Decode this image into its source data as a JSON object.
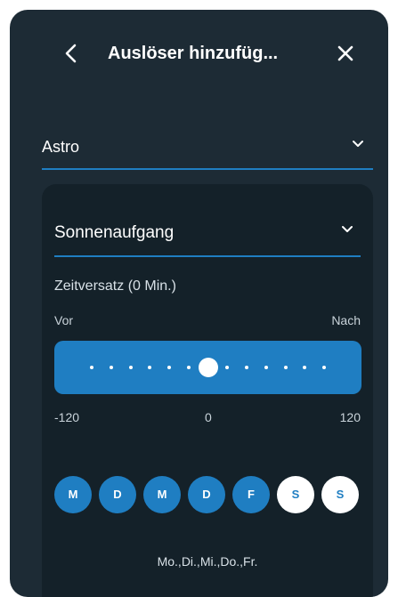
{
  "header": {
    "title": "Auslöser hinzufüg..."
  },
  "trigger_type": {
    "value": "Astro"
  },
  "event": {
    "value": "Sonnenaufgang"
  },
  "offset": {
    "label": "Zeitversatz (0 Min.)",
    "before_label": "Vor",
    "after_label": "Nach",
    "min_label": "-120",
    "mid_label": "0",
    "max_label": "120",
    "value": 0,
    "min": -120,
    "max": 120
  },
  "days": [
    {
      "label": "M",
      "active": true
    },
    {
      "label": "D",
      "active": true
    },
    {
      "label": "M",
      "active": true
    },
    {
      "label": "D",
      "active": true
    },
    {
      "label": "F",
      "active": true
    },
    {
      "label": "S",
      "active": false
    },
    {
      "label": "S",
      "active": false
    }
  ],
  "days_summary": "Mo.,Di.,Mi.,Do.,Fr.",
  "colors": {
    "background": "#1d2b35",
    "card": "#142129",
    "accent": "#1f7ec2"
  }
}
